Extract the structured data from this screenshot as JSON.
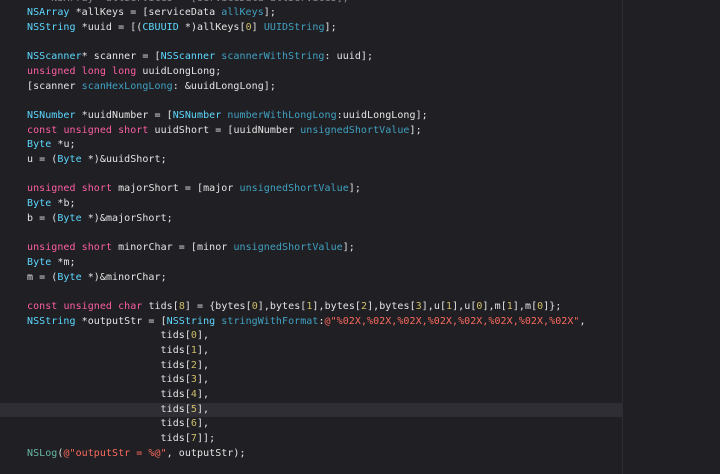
{
  "colors": {
    "background": "#1f1f24",
    "current_line": "#2e2e34",
    "plain": "#e4e4e4",
    "keyword": "#fc5fa3",
    "type": "#5dd8ff",
    "method": "#41a1c0",
    "method_alt": "#67b7a4",
    "number": "#d0bf69",
    "string": "#fc6a5d"
  },
  "editor": {
    "current_line_index": 28,
    "lines": [
      [
        [
          "plain",
          "    "
        ],
        [
          "faded",
          "NSArray *allServices = [serviceData allServices];"
        ]
      ],
      [
        [
          "type",
          "NSArray"
        ],
        [
          "plain",
          " *allKeys = [serviceData "
        ],
        [
          "method",
          "allKeys"
        ],
        [
          "plain",
          "];"
        ]
      ],
      [
        [
          "type",
          "NSString"
        ],
        [
          "plain",
          " *uuid = [("
        ],
        [
          "type",
          "CBUUID"
        ],
        [
          "plain",
          " *)allKeys["
        ],
        [
          "number",
          "0"
        ],
        [
          "plain",
          "] "
        ],
        [
          "method",
          "UUIDString"
        ],
        [
          "plain",
          "];"
        ]
      ],
      [],
      [
        [
          "type",
          "NSScanner"
        ],
        [
          "plain",
          "* scanner = ["
        ],
        [
          "type",
          "NSScanner"
        ],
        [
          "plain",
          " "
        ],
        [
          "method",
          "scannerWithString"
        ],
        [
          "plain",
          ": uuid];"
        ]
      ],
      [
        [
          "keyword",
          "unsigned"
        ],
        [
          "plain",
          " "
        ],
        [
          "keyword",
          "long"
        ],
        [
          "plain",
          " "
        ],
        [
          "keyword",
          "long"
        ],
        [
          "plain",
          " uuidLongLong;"
        ]
      ],
      [
        [
          "plain",
          "[scanner "
        ],
        [
          "method",
          "scanHexLongLong"
        ],
        [
          "plain",
          ": &uuidLongLong];"
        ]
      ],
      [],
      [
        [
          "type",
          "NSNumber"
        ],
        [
          "plain",
          " *uuidNumber = ["
        ],
        [
          "type",
          "NSNumber"
        ],
        [
          "plain",
          " "
        ],
        [
          "method",
          "numberWithLongLong"
        ],
        [
          "plain",
          ":uuidLongLong];"
        ]
      ],
      [
        [
          "keyword",
          "const"
        ],
        [
          "plain",
          " "
        ],
        [
          "keyword",
          "unsigned"
        ],
        [
          "plain",
          " "
        ],
        [
          "keyword",
          "short"
        ],
        [
          "plain",
          " uuidShort = [uuidNumber "
        ],
        [
          "method",
          "unsignedShortValue"
        ],
        [
          "plain",
          "];"
        ]
      ],
      [
        [
          "type",
          "Byte"
        ],
        [
          "plain",
          " *u;"
        ]
      ],
      [
        [
          "plain",
          "u = ("
        ],
        [
          "type",
          "Byte"
        ],
        [
          "plain",
          " *)&uuidShort;"
        ]
      ],
      [],
      [
        [
          "keyword",
          "unsigned"
        ],
        [
          "plain",
          " "
        ],
        [
          "keyword",
          "short"
        ],
        [
          "plain",
          " majorShort = [major "
        ],
        [
          "method",
          "unsignedShortValue"
        ],
        [
          "plain",
          "];"
        ]
      ],
      [
        [
          "type",
          "Byte"
        ],
        [
          "plain",
          " *b;"
        ]
      ],
      [
        [
          "plain",
          "b = ("
        ],
        [
          "type",
          "Byte"
        ],
        [
          "plain",
          " *)&majorShort;"
        ]
      ],
      [],
      [
        [
          "keyword",
          "unsigned"
        ],
        [
          "plain",
          " "
        ],
        [
          "keyword",
          "short"
        ],
        [
          "plain",
          " minorChar = [minor "
        ],
        [
          "method",
          "unsignedShortValue"
        ],
        [
          "plain",
          "];"
        ]
      ],
      [
        [
          "type",
          "Byte"
        ],
        [
          "plain",
          " *m;"
        ]
      ],
      [
        [
          "plain",
          "m = ("
        ],
        [
          "type",
          "Byte"
        ],
        [
          "plain",
          " *)&minorChar;"
        ]
      ],
      [],
      [
        [
          "keyword",
          "const"
        ],
        [
          "plain",
          " "
        ],
        [
          "keyword",
          "unsigned"
        ],
        [
          "plain",
          " "
        ],
        [
          "keyword",
          "char"
        ],
        [
          "plain",
          " tids["
        ],
        [
          "number",
          "8"
        ],
        [
          "plain",
          "] = {bytes["
        ],
        [
          "number",
          "0"
        ],
        [
          "plain",
          "],bytes["
        ],
        [
          "number",
          "1"
        ],
        [
          "plain",
          "],bytes["
        ],
        [
          "number",
          "2"
        ],
        [
          "plain",
          "],bytes["
        ],
        [
          "number",
          "3"
        ],
        [
          "plain",
          "],u["
        ],
        [
          "number",
          "1"
        ],
        [
          "plain",
          "],u["
        ],
        [
          "number",
          "0"
        ],
        [
          "plain",
          "],m["
        ],
        [
          "number",
          "1"
        ],
        [
          "plain",
          "],m["
        ],
        [
          "number",
          "0"
        ],
        [
          "plain",
          "]};"
        ]
      ],
      [
        [
          "type",
          "NSString"
        ],
        [
          "plain",
          " *outputStr = ["
        ],
        [
          "type",
          "NSString"
        ],
        [
          "plain",
          " "
        ],
        [
          "method",
          "stringWithFormat"
        ],
        [
          "plain",
          ":"
        ],
        [
          "string",
          "@\"%02X,%02X,%02X,%02X,%02X,%02X,%02X,%02X\""
        ],
        [
          "plain",
          ","
        ]
      ],
      [
        [
          "plain",
          "                      tids["
        ],
        [
          "number",
          "0"
        ],
        [
          "plain",
          "],"
        ]
      ],
      [
        [
          "plain",
          "                      tids["
        ],
        [
          "number",
          "1"
        ],
        [
          "plain",
          "],"
        ]
      ],
      [
        [
          "plain",
          "                      tids["
        ],
        [
          "number",
          "2"
        ],
        [
          "plain",
          "],"
        ]
      ],
      [
        [
          "plain",
          "                      tids["
        ],
        [
          "number",
          "3"
        ],
        [
          "plain",
          "],"
        ]
      ],
      [
        [
          "plain",
          "                      tids["
        ],
        [
          "number",
          "4"
        ],
        [
          "plain",
          "],"
        ]
      ],
      [
        [
          "plain",
          "                      tids["
        ],
        [
          "number",
          "5"
        ],
        [
          "plain",
          "],"
        ]
      ],
      [
        [
          "plain",
          "                      tids["
        ],
        [
          "number",
          "6"
        ],
        [
          "plain",
          "],"
        ]
      ],
      [
        [
          "plain",
          "                      tids["
        ],
        [
          "number",
          "7"
        ],
        [
          "plain",
          "]];"
        ]
      ],
      [
        [
          "method2",
          "NSLog"
        ],
        [
          "plain",
          "("
        ],
        [
          "string",
          "@\"outputStr = %@\""
        ],
        [
          "plain",
          ", outputStr);"
        ]
      ]
    ]
  }
}
